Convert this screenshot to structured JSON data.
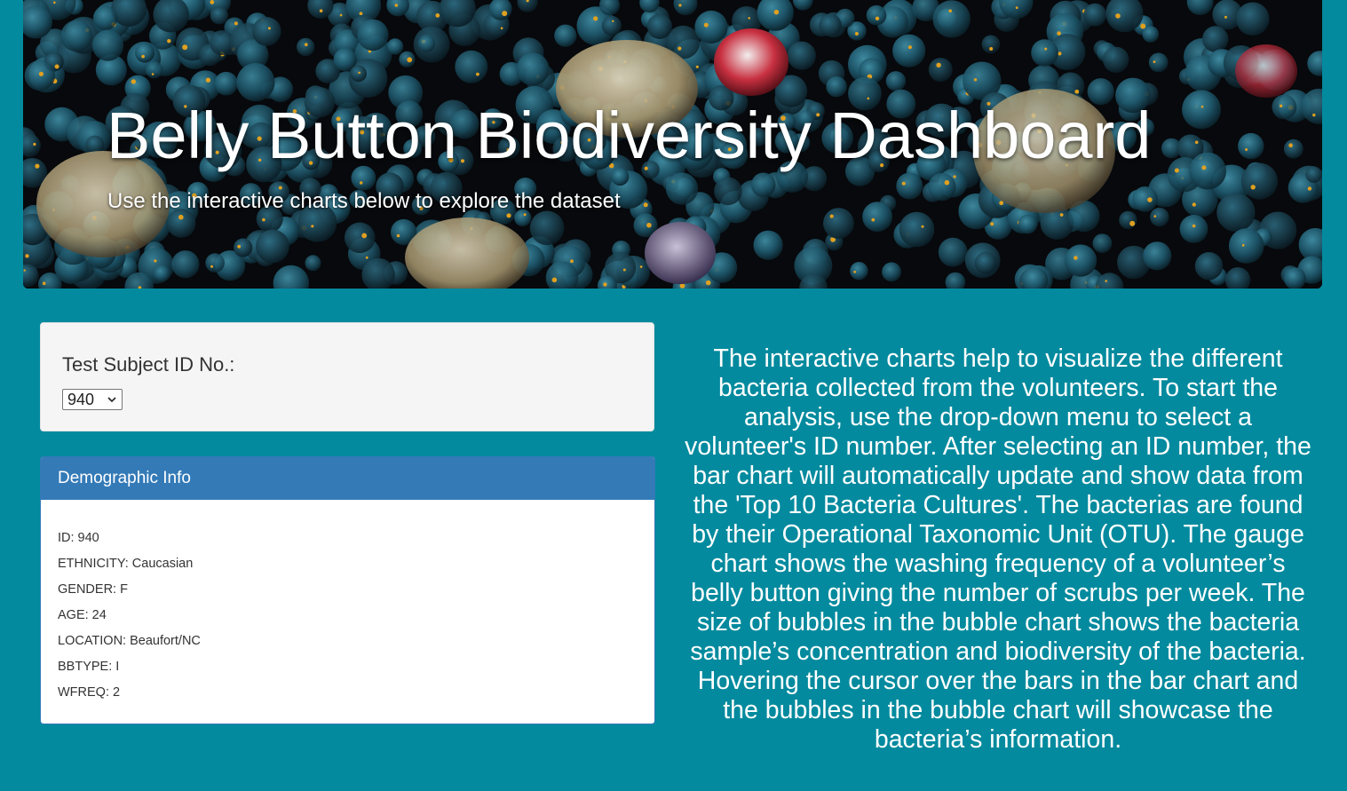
{
  "header": {
    "title": "Belly Button Biodiversity Dashboard",
    "subtitle": "Use the interactive charts below to explore the dataset"
  },
  "selector": {
    "label": "Test Subject ID No.:",
    "selected_value": "940"
  },
  "demographics": {
    "heading": "Demographic Info",
    "lines": [
      "ID: 940",
      "ETHNICITY: Caucasian",
      "GENDER: F",
      "AGE: 24",
      "LOCATION: Beaufort/NC",
      "BBTYPE: I",
      "WFREQ: 2"
    ]
  },
  "description": {
    "text": "The interactive charts help to visualize the different bacteria collected from the volunteers. To start the analysis, use the drop-down menu to select a volunteer's ID number. After selecting an ID number, the bar chart will automatically update and show data from the 'Top 10 Bacteria Cultures'. The bacterias are found by their Operational Taxonomic Unit (OTU). The gauge chart shows the washing frequency of a volunteer’s belly button giving the number of scrubs per week. The size of bubbles in the bubble chart shows the bacteria sample’s concentration and biodiversity of the bacteria. Hovering the cursor over the bars in the bar chart and the bubbles in the bubble chart will showcase the bacteria’s information."
  },
  "colors": {
    "page_background": "#038a9e",
    "panel_heading": "#337ab7",
    "well_background": "#f5f5f5",
    "text_light": "#ffffff"
  },
  "icons": {
    "select_arrow": "chevron-down-icon"
  }
}
